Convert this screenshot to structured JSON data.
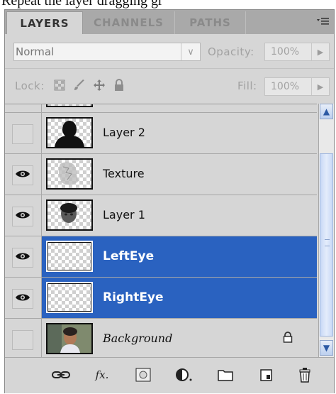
{
  "caption": "Repeat the layer dragging gr",
  "tabs": [
    {
      "label": "LAYERS",
      "active": true
    },
    {
      "label": "CHANNELS",
      "active": false
    },
    {
      "label": "PATHS",
      "active": false
    }
  ],
  "blend": {
    "mode": "Normal",
    "opacity_label": "Opacity:",
    "opacity_value": "100%",
    "lock_label": "Lock:",
    "fill_label": "Fill:",
    "fill_value": "100%"
  },
  "layers": [
    {
      "name": "Layer 2",
      "visible": false,
      "selected": false,
      "thumbnail": "silhouette"
    },
    {
      "name": "Texture",
      "visible": true,
      "selected": false,
      "thumbnail": "texture"
    },
    {
      "name": "Layer 1",
      "visible": true,
      "selected": false,
      "thumbnail": "face-cutout"
    },
    {
      "name": "LeftEye",
      "visible": true,
      "selected": true,
      "thumbnail": "transparent"
    },
    {
      "name": "RightEye",
      "visible": true,
      "selected": true,
      "thumbnail": "transparent"
    },
    {
      "name": "Background",
      "visible": false,
      "selected": false,
      "thumbnail": "photo",
      "locked": true
    }
  ],
  "bottom_icons": [
    "link-icon",
    "fx-icon",
    "mask-icon",
    "adjustment-icon",
    "folder-icon",
    "new-layer-icon",
    "trash-icon"
  ],
  "colors": {
    "selection": "#2a62c0",
    "panel": "#d6d6d6",
    "tab_bar": "#a9a9a9"
  }
}
